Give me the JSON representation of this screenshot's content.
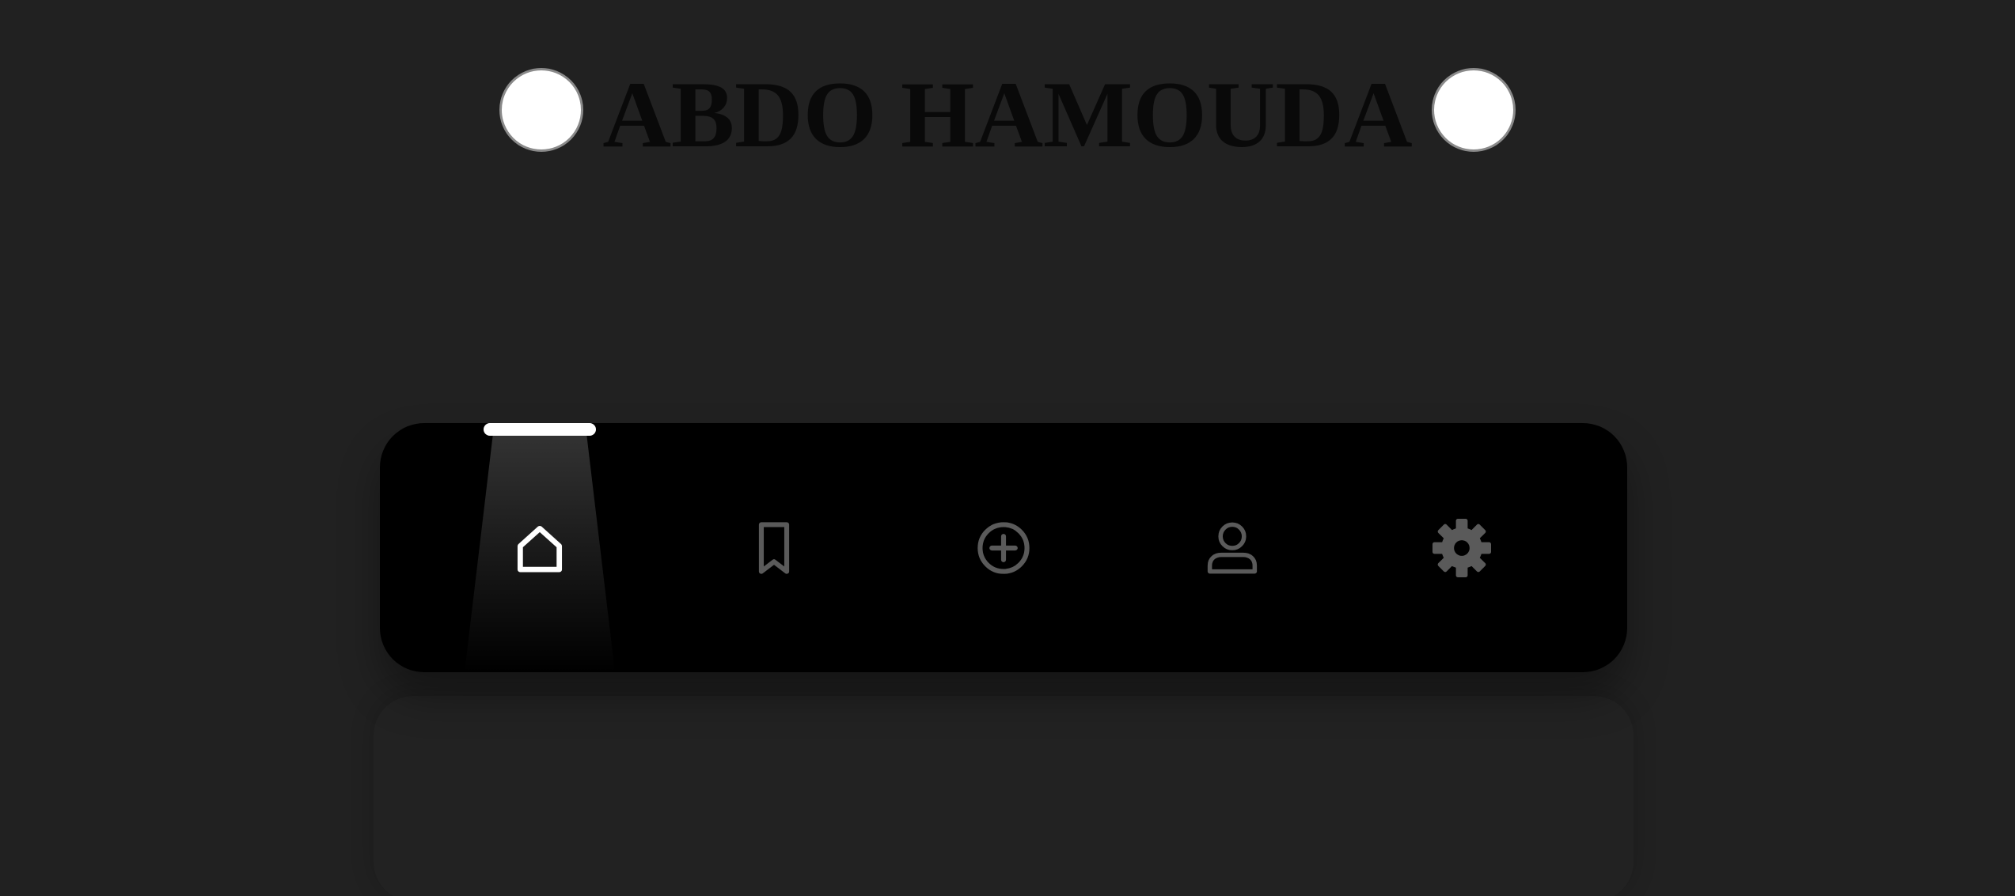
{
  "header": {
    "brand_title": "ABDO HAMOUDA"
  },
  "navbar": {
    "active_item": "home",
    "items": [
      {
        "id": "home",
        "icon": "home-icon",
        "active": true
      },
      {
        "id": "bookmarks",
        "icon": "bookmark-icon",
        "active": false
      },
      {
        "id": "add",
        "icon": "plus-circle-icon",
        "active": false
      },
      {
        "id": "profile",
        "icon": "user-icon",
        "active": false
      },
      {
        "id": "settings",
        "icon": "gear-icon",
        "active": false
      }
    ]
  },
  "colors": {
    "background": "#212121",
    "navbar": "#000000",
    "active_icon": "#ffffff",
    "inactive_icon": "#5a5a5a",
    "title": "#090909"
  }
}
